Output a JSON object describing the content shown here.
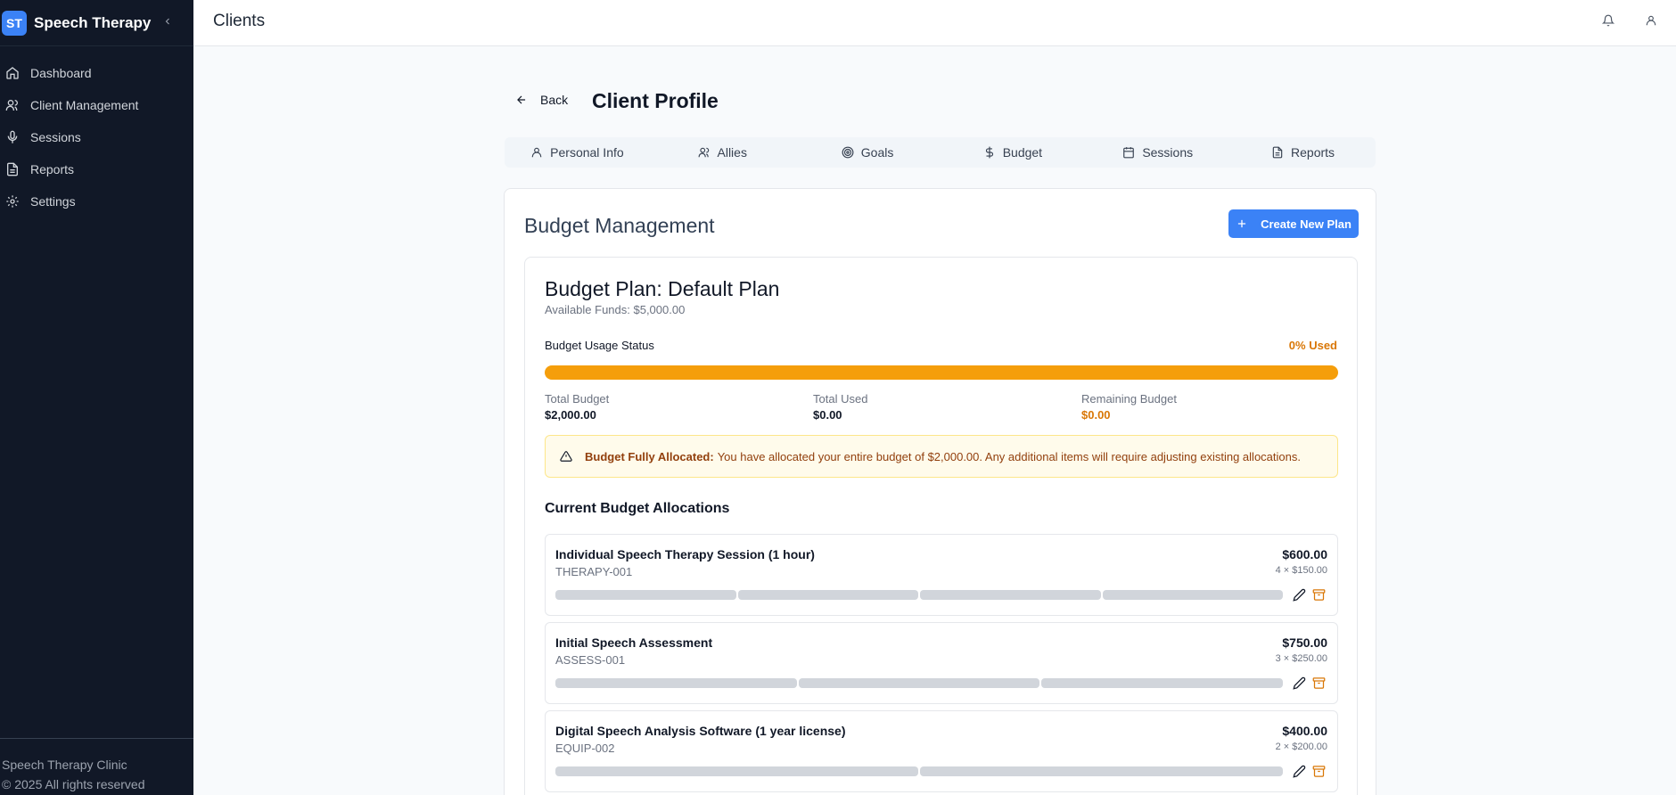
{
  "sidebar": {
    "logo": "ST",
    "app_name": "Speech Therapy",
    "items": [
      {
        "label": "Dashboard"
      },
      {
        "label": "Client Management"
      },
      {
        "label": "Sessions"
      },
      {
        "label": "Reports"
      },
      {
        "label": "Settings"
      }
    ],
    "footer_line1": "Speech Therapy Clinic",
    "footer_line2": "© 2025 All rights reserved"
  },
  "topbar": {
    "title": "Clients"
  },
  "header": {
    "back_label": "Back",
    "title": "Client Profile"
  },
  "tabs": [
    {
      "label": "Personal Info"
    },
    {
      "label": "Allies"
    },
    {
      "label": "Goals"
    },
    {
      "label": "Budget"
    },
    {
      "label": "Sessions"
    },
    {
      "label": "Reports"
    }
  ],
  "budget": {
    "section_title": "Budget Management",
    "create_label": "Create New Plan",
    "plan_title": "Budget Plan: Default Plan",
    "available_funds": "Available Funds: $5,000.00",
    "usage_label": "Budget Usage Status",
    "usage_text": "0% Used",
    "usage_fraction": 0,
    "stats": {
      "total_budget_label": "Total Budget",
      "total_budget": "$2,000.00",
      "total_used_label": "Total Used",
      "total_used": "$0.00",
      "remaining_label": "Remaining Budget",
      "remaining": "$0.00"
    },
    "alert": {
      "title": "Budget Fully Allocated:",
      "message": "You have allocated your entire budget of $2,000.00. Any additional items will require adjusting existing allocations."
    },
    "allocations_heading": "Current Budget Allocations",
    "allocations": [
      {
        "name": "Individual Speech Therapy Session (1 hour)",
        "code": "THERAPY-001",
        "total": "$600.00",
        "calc": "4 × $150.00",
        "units": 4
      },
      {
        "name": "Initial Speech Assessment",
        "code": "ASSESS-001",
        "total": "$750.00",
        "calc": "3 × $250.00",
        "units": 3
      },
      {
        "name": "Digital Speech Analysis Software (1 year license)",
        "code": "EQUIP-002",
        "total": "$400.00",
        "calc": "2 × $200.00",
        "units": 2
      }
    ]
  }
}
